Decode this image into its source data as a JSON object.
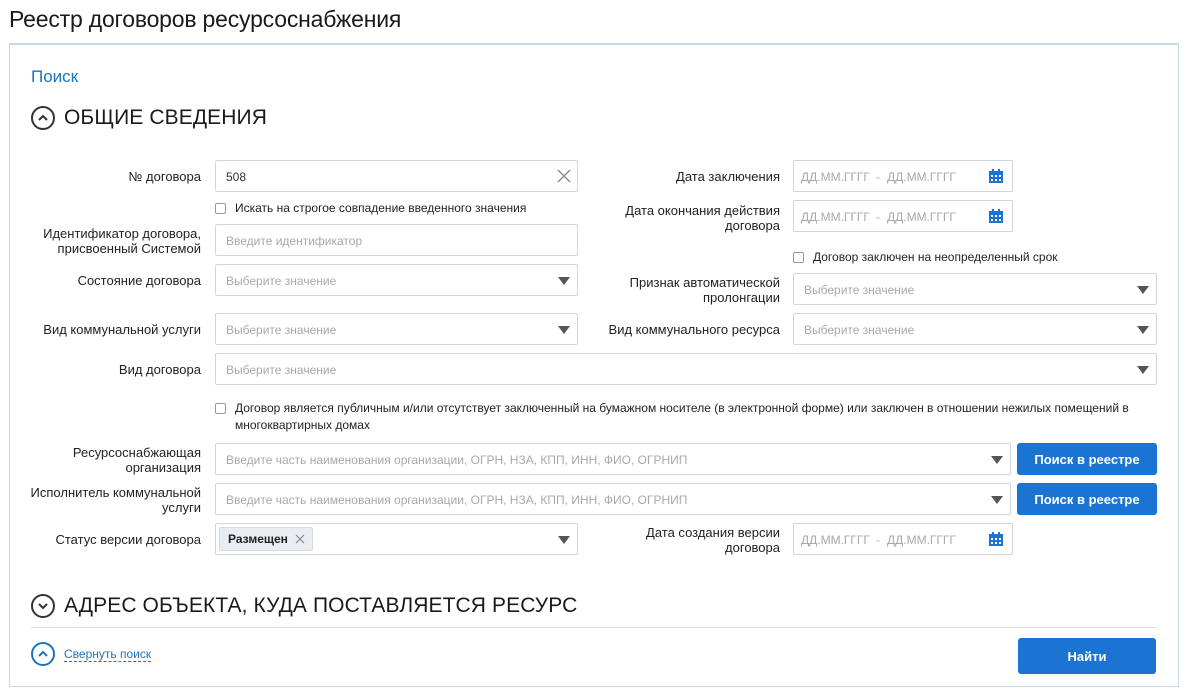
{
  "page": {
    "title": "Реестр договоров ресурсоснабжения"
  },
  "search": {
    "link_label": "Поиск",
    "general_section": "ОБЩИЕ СВЕДЕНИЯ",
    "address_section": "АДРЕС ОБЪЕКТА, КУДА ПОСТАВЛЯЕТСЯ РЕСУРС",
    "collapse_label": "Свернуть поиск",
    "find_button": "Найти"
  },
  "form": {
    "contract_no": {
      "label": "№ договора",
      "value": "508"
    },
    "strict_match": {
      "label": "Искать на строгое совпадение введенного значения"
    },
    "system_id": {
      "label1": "Идентификатор договора,",
      "label2": "присвоенный Системой",
      "placeholder": "Введите идентификатор"
    },
    "state": {
      "label": "Состояние договора",
      "placeholder": "Выберите значение"
    },
    "service_type": {
      "label": "Вид коммунальной услуги",
      "placeholder": "Выберите значение"
    },
    "contract_type": {
      "label": "Вид договора",
      "placeholder": "Выберите значение"
    },
    "public_contract": {
      "label": "Договор является публичным и/или отсутствует заключенный на бумажном носителе (в электронной форме) или заключен в отношении нежилых помещений в многоквартирных домах"
    },
    "supplier": {
      "label1": "Ресурсоснабжающая",
      "label2": "организация",
      "placeholder": "Введите часть наименования организации, ОГРН, НЗА, КПП, ИНН, ФИО, ОГРНИП",
      "button": "Поиск в реестре"
    },
    "executor": {
      "label1": "Исполнитель коммунальной",
      "label2": "услуги",
      "placeholder": "Введите часть наименования организации, ОГРН, НЗА, КПП, ИНН, ФИО, ОГРНИП",
      "button": "Поиск в реестре"
    },
    "version_status": {
      "label": "Статус версии договора",
      "tag": "Размещен"
    },
    "conclusion_date": {
      "label": "Дата заключения",
      "from": "ДД.ММ.ГГГГ",
      "sep": "-",
      "to": "ДД.ММ.ГГГГ"
    },
    "end_date": {
      "label1": "Дата окончания действия",
      "label2": "договора",
      "from": "ДД.ММ.ГГГГ",
      "sep": "-",
      "to": "ДД.ММ.ГГГГ"
    },
    "indefinite": {
      "label": "Договор заключен на неопределенный срок"
    },
    "auto_prolong": {
      "label1": "Признак автоматической",
      "label2": "пролонгации",
      "placeholder": "Выберите значение"
    },
    "resource_type": {
      "label": "Вид коммунального ресурса",
      "placeholder": "Выберите значение"
    },
    "version_date": {
      "label1": "Дата создания версии",
      "label2": "договора",
      "from": "ДД.ММ.ГГГГ",
      "sep": "-",
      "to": "ДД.ММ.ГГГГ"
    }
  },
  "colors": {
    "accent": "#1b74d1",
    "link": "#1b74bf",
    "border": "#cfd6dc"
  }
}
